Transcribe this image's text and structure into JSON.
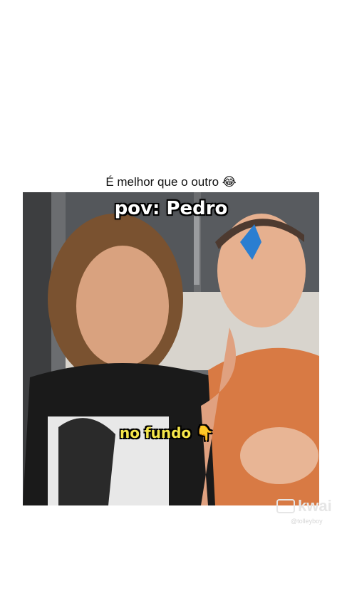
{
  "caption": "É melhor que o outro 😂",
  "video": {
    "overlay_title": "pov: Pedro",
    "overlay_subtitle": "no fundo 👇"
  },
  "watermark": {
    "brand": "kwai",
    "handle": "@tolleyboy"
  },
  "colors": {
    "background": "#ffffff",
    "subtitle_text": "#f5e64a",
    "title_text": "#ffffff"
  }
}
